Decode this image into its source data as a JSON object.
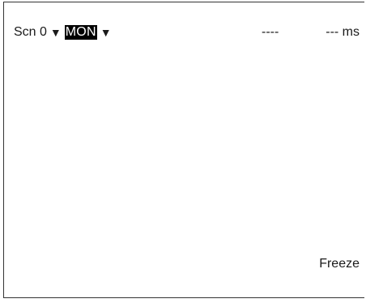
{
  "header": {
    "scene_label": "Scn 0",
    "scene_arrow": "▼",
    "mode_label": "MON",
    "mode_arrow": "▼",
    "counter": "----",
    "time": "--- ms"
  },
  "footer": {
    "freeze_label": "Freeze"
  },
  "colors": {
    "mode_badge_bg": "#000000",
    "mode_badge_text": "#ffffff",
    "border": "#333333"
  }
}
